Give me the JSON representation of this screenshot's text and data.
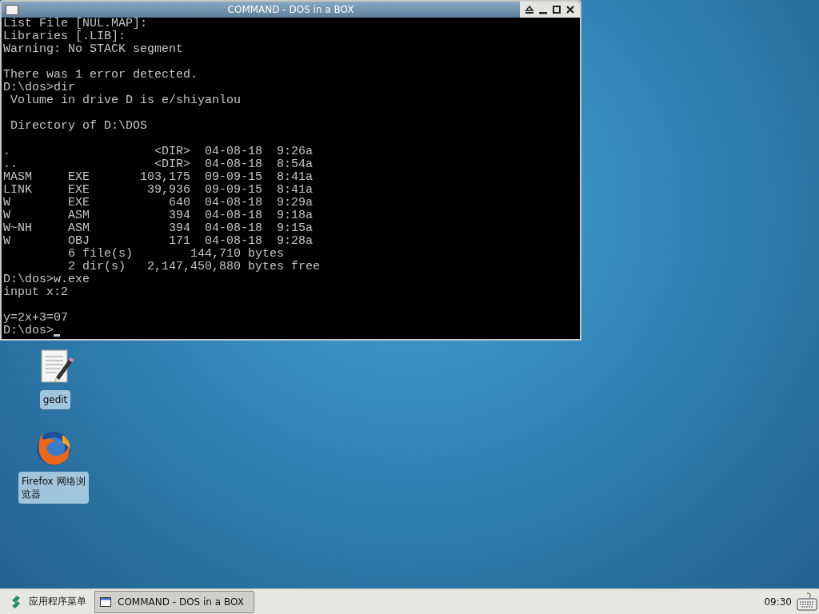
{
  "window": {
    "title": "COMMAND - DOS in a BOX",
    "terminal": {
      "blocks": [
        [
          "List File [NUL.MAP]:",
          "Libraries [.LIB]:",
          "Warning: No STACK segment"
        ],
        [
          "There was 1 error detected.",
          "D:\\dos>dir",
          " Volume in drive D is e/shiyanlou"
        ],
        [
          " Directory of D:\\DOS"
        ],
        [
          ".                    <DIR>  04-08-18  9:26a",
          "..                   <DIR>  04-08-18  8:54a",
          "MASM     EXE       103,175  09-09-15  8:41a",
          "LINK     EXE        39,936  09-09-15  8:41a",
          "W        EXE           640  04-08-18  9:29a",
          "W        ASM           394  04-08-18  9:18a",
          "W~NH     ASM           394  04-08-18  9:15a",
          "W        OBJ           171  04-08-18  9:28a",
          "         6 file(s)        144,710 bytes",
          "         2 dir(s)   2,147,450,880 bytes free",
          "D:\\dos>w.exe",
          "input x:2"
        ],
        [
          "y=2x+3=07",
          "D:\\dos>"
        ]
      ],
      "cursor": true
    }
  },
  "desktop_icons": [
    {
      "kind": "editor",
      "label": "gedit"
    },
    {
      "kind": "browser",
      "label": "Firefox 网络浏览器"
    }
  ],
  "taskbar": {
    "menu": "应用程序菜单",
    "tasks": [
      {
        "label": "COMMAND - DOS in a BOX",
        "selected": true
      }
    ],
    "clock": "09:30"
  }
}
